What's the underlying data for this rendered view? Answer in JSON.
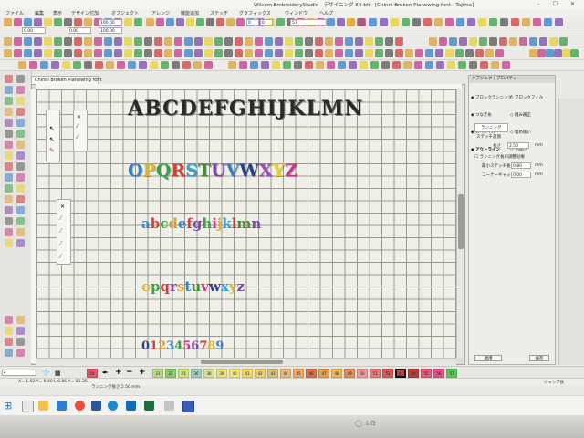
{
  "window": {
    "title": "Wilcom EmbroideryStudio - デザイニング 64-bit - [Chinni Broken Planewing font - Tajima]"
  },
  "menu": [
    "ファイル",
    "編集",
    "表示",
    "デザイン付加",
    "オブジェクト",
    "アレンジ",
    "機能追加",
    "ステッチ",
    "グラフィックス",
    "ウィンドウ",
    "ヘルプ"
  ],
  "toolbar": {
    "fields": [
      "0.00",
      "0.00",
      "100.00",
      "100.00",
      "0",
      "0",
      "57"
    ]
  },
  "document": {
    "tab_label": "Chinni Broken Planewing font"
  },
  "canvas": {
    "uppercase_black": "ABCDEFGHIJKLMN",
    "uppercase_colored": [
      {
        "char": "O",
        "color": "#3a7fc4"
      },
      {
        "char": "P",
        "color": "#d8b43a"
      },
      {
        "char": "Q",
        "color": "#3aa04a"
      },
      {
        "char": "R",
        "color": "#c94040"
      },
      {
        "char": "S",
        "color": "#3a9fc8"
      },
      {
        "char": "T",
        "color": "#4a8a3a"
      },
      {
        "char": "U",
        "color": "#7a48a8"
      },
      {
        "char": "V",
        "color": "#3a7fc4"
      },
      {
        "char": "W",
        "color": "#2c3f8a"
      },
      {
        "char": "X",
        "color": "#9a50b0"
      },
      {
        "char": "Y",
        "color": "#e6d038"
      },
      {
        "char": "Z",
        "color": "#c43a8a"
      }
    ],
    "lowercase_1": [
      {
        "char": "a",
        "color": "#3a7fc4"
      },
      {
        "char": "b",
        "color": "#c94040"
      },
      {
        "char": "c",
        "color": "#3aa04a"
      },
      {
        "char": "d",
        "color": "#d8a03a"
      },
      {
        "char": "e",
        "color": "#3a7fc4"
      },
      {
        "char": "f",
        "color": "#c94040"
      },
      {
        "char": "g",
        "color": "#7a48a8"
      },
      {
        "char": "h",
        "color": "#3aa04a"
      },
      {
        "char": "i",
        "color": "#c43a8a"
      },
      {
        "char": "j",
        "color": "#d8b43a"
      },
      {
        "char": "k",
        "color": "#3a9fc8"
      },
      {
        "char": "l",
        "color": "#c94040"
      },
      {
        "char": "m",
        "color": "#4a8a3a"
      },
      {
        "char": "n",
        "color": "#7a48a8"
      }
    ],
    "lowercase_2": [
      {
        "char": "o",
        "color": "#d8b43a"
      },
      {
        "char": "p",
        "color": "#3aa04a"
      },
      {
        "char": "q",
        "color": "#c94040"
      },
      {
        "char": "r",
        "color": "#7a48a8"
      },
      {
        "char": "s",
        "color": "#d8a03a"
      },
      {
        "char": "t",
        "color": "#3a7fc4"
      },
      {
        "char": "u",
        "color": "#4a8a3a"
      },
      {
        "char": "v",
        "color": "#c43a8a"
      },
      {
        "char": "w",
        "color": "#2c3f8a"
      },
      {
        "char": "x",
        "color": "#3a9fc8"
      },
      {
        "char": "y",
        "color": "#d8b43a"
      },
      {
        "char": "z",
        "color": "#7a48a8"
      }
    ],
    "digits": [
      {
        "char": "0",
        "color": "#2c3f8a"
      },
      {
        "char": "1",
        "color": "#c94040"
      },
      {
        "char": "2",
        "color": "#d8a03a"
      },
      {
        "char": "3",
        "color": "#3a7fc4"
      },
      {
        "char": "4",
        "color": "#3aa04a"
      },
      {
        "char": "5",
        "color": "#c43a8a"
      },
      {
        "char": "6",
        "color": "#7a48a8"
      },
      {
        "char": "7",
        "color": "#c94040"
      },
      {
        "char": "8",
        "color": "#d8b43a"
      },
      {
        "char": "9",
        "color": "#3a7fc4"
      }
    ]
  },
  "object_properties": {
    "title": "オブジェクトプロパティ",
    "tabs": [
      "ブロックランニング",
      "ブロックフィル",
      "つなぎ糸",
      "縫み補正",
      "スペシャル",
      "埋め抜い",
      "アウトライン",
      "下縫い"
    ],
    "active_tab": "アウトライン",
    "section": "ランニング",
    "stitch_label": "ステッチ計測",
    "length_label": "長さ",
    "length_value": "2.50",
    "unit": "mm",
    "checkbox_label": "ランニング長の調整効果",
    "min_length_label": "最小ステッチ長",
    "min_length_value": "0.80",
    "corner_label": "コーナーギャップ",
    "corner_value": "0.00",
    "apply_button": "適用",
    "save_button": "保存"
  },
  "colorbar": {
    "swatches": [
      {
        "label": "21",
        "color": "#b9d98a"
      },
      {
        "label": "22",
        "color": "#8fcf6a"
      },
      {
        "label": "23",
        "color": "#cbe27a"
      },
      {
        "label": "36",
        "color": "#9fd0b8"
      },
      {
        "label": "38",
        "color": "#d8e09a"
      },
      {
        "label": "39",
        "color": "#e6e27a"
      },
      {
        "label": "40",
        "color": "#f0e67a"
      },
      {
        "label": "41",
        "color": "#f2d85a"
      },
      {
        "label": "42",
        "color": "#efcf6a"
      },
      {
        "label": "43",
        "color": "#d8c27a"
      },
      {
        "label": "44",
        "color": "#e9b87a"
      },
      {
        "label": "45",
        "color": "#f0a86a"
      },
      {
        "label": "46",
        "color": "#d8734a"
      },
      {
        "label": "47",
        "color": "#e6a04a"
      },
      {
        "label": "48",
        "color": "#f0b45a"
      },
      {
        "label": "49",
        "color": "#e68a5a"
      },
      {
        "label": "50",
        "color": "#ef9a9a"
      },
      {
        "label": "51",
        "color": "#e67a7a"
      },
      {
        "label": "52",
        "color": "#d85a5a"
      },
      {
        "label": "53",
        "color": "#c94040"
      },
      {
        "label": "54",
        "color": "#b83a3a"
      },
      {
        "label": "55",
        "color": "#e65a7a"
      },
      {
        "label": "56",
        "color": "#e6508a"
      },
      {
        "label": "57",
        "color": "#5ac85a"
      }
    ],
    "current_color_label": "54",
    "current_color": "#e25a6a"
  },
  "statusbar": {
    "coords": "X= 1.02 Y= 6.40 L 6.86 A= 81.35",
    "stitch_length": "ランニング長さ 2.50 mm",
    "right": "ジャンプ長"
  }
}
